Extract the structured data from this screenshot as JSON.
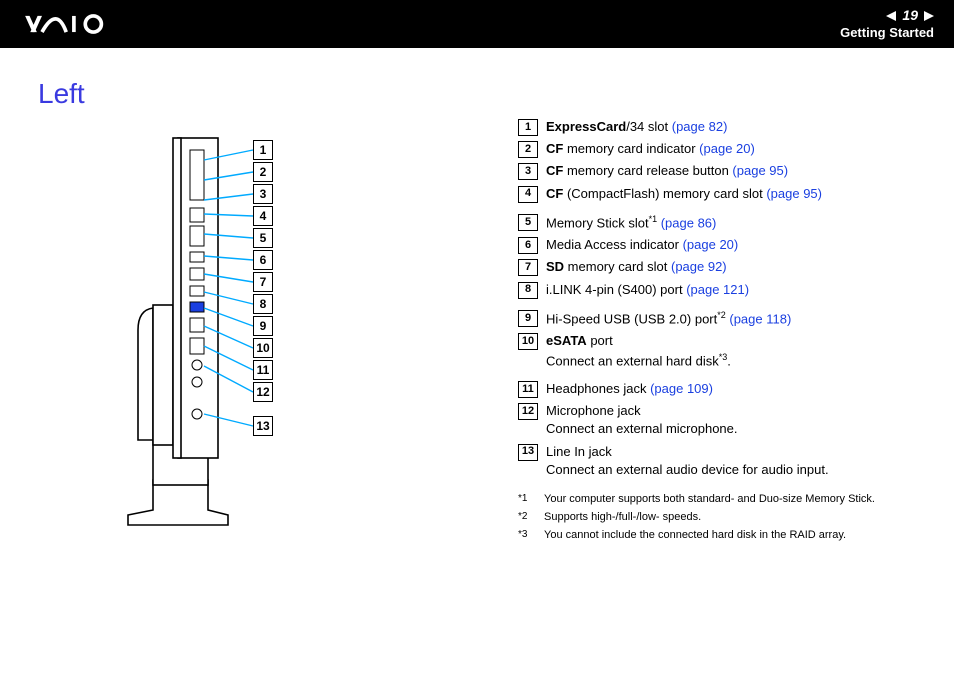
{
  "header": {
    "page_number": "19",
    "section": "Getting Started"
  },
  "title": "Left",
  "callouts": [
    "1",
    "2",
    "3",
    "4",
    "5",
    "6",
    "7",
    "8",
    "9",
    "10",
    "11",
    "12",
    "13"
  ],
  "items": [
    {
      "num": "1",
      "parts": [
        {
          "t": "ExpressCard",
          "cls": "bold"
        },
        {
          "t": "/34 slot "
        },
        {
          "t": "(page 82)",
          "cls": "link",
          "interact": true,
          "name": "link-page-82"
        }
      ]
    },
    {
      "num": "2",
      "parts": [
        {
          "t": "CF",
          "cls": "bold"
        },
        {
          "t": " memory card indicator "
        },
        {
          "t": "(page 20)",
          "cls": "link",
          "interact": true,
          "name": "link-page-20"
        }
      ]
    },
    {
      "num": "3",
      "parts": [
        {
          "t": "CF",
          "cls": "bold"
        },
        {
          "t": " memory card release button "
        },
        {
          "t": "(page 95)",
          "cls": "link",
          "interact": true,
          "name": "link-page-95"
        }
      ]
    },
    {
      "num": "4",
      "parts": [
        {
          "t": "CF",
          "cls": "bold"
        },
        {
          "t": " (CompactFlash) memory card slot "
        },
        {
          "t": "(page 95)",
          "cls": "link",
          "interact": true,
          "name": "link-page-95"
        }
      ]
    },
    {
      "num": "5",
      "space_before": true,
      "parts": [
        {
          "t": "Memory Stick slot"
        },
        {
          "t": "*1",
          "sup": true
        },
        {
          "t": " "
        },
        {
          "t": "(page 86)",
          "cls": "link",
          "interact": true,
          "name": "link-page-86"
        }
      ]
    },
    {
      "num": "6",
      "parts": [
        {
          "t": "Media Access indicator "
        },
        {
          "t": "(page 20)",
          "cls": "link",
          "interact": true,
          "name": "link-page-20"
        }
      ]
    },
    {
      "num": "7",
      "parts": [
        {
          "t": "SD",
          "cls": "bold"
        },
        {
          "t": " memory card slot "
        },
        {
          "t": "(page 92)",
          "cls": "link",
          "interact": true,
          "name": "link-page-92"
        }
      ]
    },
    {
      "num": "8",
      "parts": [
        {
          "t": "i.LINK 4-pin (S400) port "
        },
        {
          "t": "(page 121)",
          "cls": "link",
          "interact": true,
          "name": "link-page-121"
        }
      ]
    },
    {
      "num": "9",
      "space_before": true,
      "parts": [
        {
          "t": "Hi-Speed USB (USB 2.0) port"
        },
        {
          "t": "*2",
          "sup": true
        },
        {
          "t": " "
        },
        {
          "t": "(page 118)",
          "cls": "link",
          "interact": true,
          "name": "link-page-118"
        }
      ]
    },
    {
      "num": "10",
      "parts": [
        {
          "t": "eSATA",
          "cls": "bold"
        },
        {
          "t": " port"
        }
      ],
      "sub_parts": [
        {
          "t": "Connect an external hard disk"
        },
        {
          "t": "*3",
          "sup": true
        },
        {
          "t": "."
        }
      ]
    },
    {
      "num": "11",
      "space_before": true,
      "parts": [
        {
          "t": "Headphones jack "
        },
        {
          "t": "(page 109)",
          "cls": "link",
          "interact": true,
          "name": "link-page-109"
        }
      ]
    },
    {
      "num": "12",
      "parts": [
        {
          "t": "Microphone jack"
        }
      ],
      "sub_parts": [
        {
          "t": "Connect an external microphone."
        }
      ]
    },
    {
      "num": "13",
      "parts": [
        {
          "t": "Line In jack"
        }
      ],
      "sub_parts": [
        {
          "t": "Connect an external audio device for audio input."
        }
      ]
    }
  ],
  "footnotes": [
    {
      "mark": "*1",
      "text": "Your computer supports both standard- and Duo-size Memory Stick."
    },
    {
      "mark": "*2",
      "text": "Supports high-/full-/low- speeds."
    },
    {
      "mark": "*3",
      "text": "You cannot include the connected hard disk in the RAID array."
    }
  ]
}
